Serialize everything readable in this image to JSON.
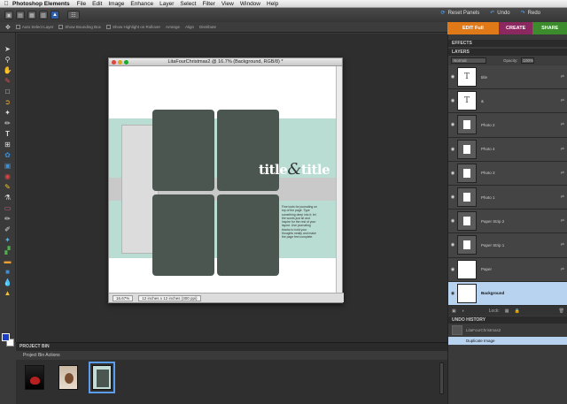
{
  "menubar": {
    "apple": "",
    "app": "Photoshop Elements",
    "items": [
      "File",
      "Edit",
      "Image",
      "Enhance",
      "Layer",
      "Select",
      "Filter",
      "View",
      "Window",
      "Help"
    ]
  },
  "toolbar": {
    "reset_panels": "Reset Panels",
    "undo": "Undo",
    "redo": "Redo"
  },
  "options": {
    "auto_select": "Auto Select Layer",
    "bounding_box": "Show Bounding Box",
    "highlight": "Show Highlight on Rollover",
    "arrange": "Arrange",
    "align": "Align",
    "distribute": "Distribute"
  },
  "mode_tabs": {
    "edit": "EDIT Full",
    "create": "CREATE",
    "share": "SHARE"
  },
  "document": {
    "title": "LitaFourChristmas2 @ 16.7% (Background, RGB/8) *",
    "zoom": "16.67%",
    "doc_size": "12 inches x 12 inches (300 ppi)",
    "canvas_title": "title",
    "canvas_amp": "&",
    "canvas_title2": "title",
    "journal": "Fine tools for journaling on top of the page. Type something deep into it; let the words just sit and inspire for the rest of your layout. Use journaling blocks to hold your thoughts neatly and make the page feel complete."
  },
  "panels": {
    "effects": "EFFECTS",
    "layers": "LAYERS",
    "blend_mode": "Normal",
    "opacity_label": "Opacity:",
    "opacity": "100%",
    "lock_label": "Lock:",
    "layers_list": [
      {
        "name": "title",
        "kind": "text",
        "glyph": "T"
      },
      {
        "name": "&",
        "kind": "text",
        "glyph": "T"
      },
      {
        "name": "Photo 2",
        "kind": "image",
        "glyph": ""
      },
      {
        "name": "Photo 4",
        "kind": "image",
        "glyph": ""
      },
      {
        "name": "Photo 3",
        "kind": "image",
        "glyph": ""
      },
      {
        "name": "Photo 1",
        "kind": "image",
        "glyph": ""
      },
      {
        "name": "Paper Strip 2",
        "kind": "image",
        "glyph": ""
      },
      {
        "name": "Paper Strip 1",
        "kind": "image",
        "glyph": ""
      },
      {
        "name": "Paper",
        "kind": "white",
        "glyph": ""
      },
      {
        "name": "Background",
        "kind": "white",
        "glyph": "",
        "active": true
      }
    ],
    "undo_history": "UNDO HISTORY",
    "undo_items": [
      "LitaFourChristmas2",
      "Duplicate Image"
    ]
  },
  "project_bin": {
    "title": "PROJECT BIN",
    "actions": "Project Bin Actions"
  },
  "colors": {
    "edit_tab": "#e07a18",
    "create_tab": "#8b2860",
    "share_tab": "#3c8b2c",
    "mint": "#b9dcd3",
    "photo_slot": "#4c5650",
    "foreground": "#1a40c8"
  }
}
